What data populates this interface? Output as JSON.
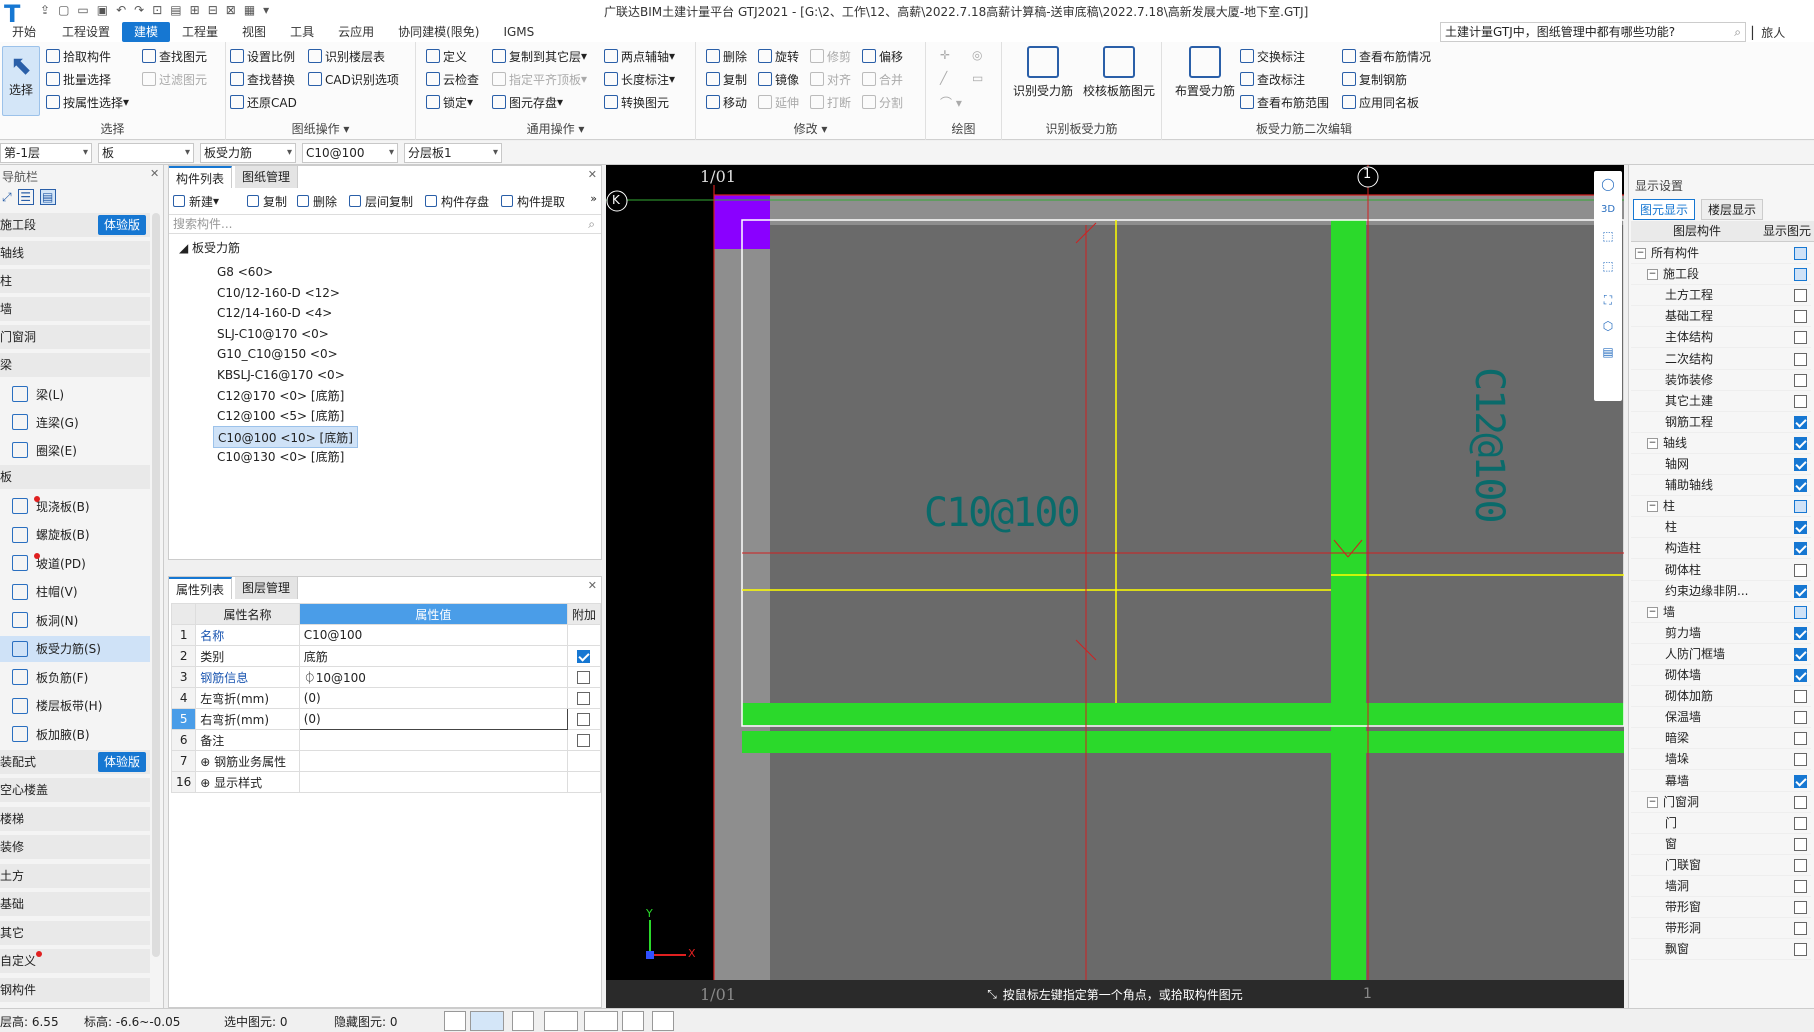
{
  "window_title": "广联达BIM土建计量平台 GTJ2021 - [G:\\2、工作\\12、高薪\\2022.7.18高薪计算稿-送审底稿\\2022.7.18\\高新发展大厦-地下室.GTJ]",
  "menu_tabs": [
    "开始",
    "工程设置",
    "建模",
    "工程量",
    "视图",
    "工具",
    "云应用",
    "协同建模(限免)",
    "IGMS"
  ],
  "active_tab": "建模",
  "help_search": "土建计量GTJ中，图纸管理中都有哪些功能?",
  "user": "旅人",
  "ribbon": {
    "select_big": "选择",
    "select_items": [
      "拾取构件",
      "批量选择",
      "按属性选择",
      "查找图元",
      "过滤图元"
    ],
    "select_group": "选择",
    "drawing_items": [
      "设置比例",
      "识别楼层表",
      "查找替换",
      "CAD识别选项",
      "还原CAD"
    ],
    "drawing_group": "图纸操作 ▾",
    "general_items": [
      "定义",
      "复制到其它层",
      "两点辅轴",
      "云检查",
      "指定平齐顶板",
      "长度标注",
      "锁定",
      "图元存盘",
      "转换图元"
    ],
    "general_group": "通用操作 ▾",
    "modify_items": [
      "删除",
      "旋转",
      "修剪",
      "偏移",
      "复制",
      "镜像",
      "对齐",
      "合并",
      "移动",
      "延伸",
      "打断",
      "分割"
    ],
    "modify_group": "修改 ▾",
    "draw_group": "绘图",
    "recog_items": [
      "识别受力筋",
      "校核板筋图元"
    ],
    "recog_group": "识别板受力筋",
    "edit_big": "布置受力筋",
    "edit_items": [
      "交换标注",
      "查改标注",
      "查看布筋范围",
      "查看布筋情况",
      "复制钢筋",
      "应用同名板"
    ],
    "edit_group": "板受力筋二次编辑"
  },
  "selectors": [
    "第-1层",
    "板",
    "板受力筋",
    "C10@100",
    "分层板1"
  ],
  "nav": {
    "title": "导航栏",
    "sections": [
      {
        "label": "施工段",
        "badge": "体验版"
      },
      {
        "label": "轴线"
      },
      {
        "label": "柱"
      },
      {
        "label": "墙"
      },
      {
        "label": "门窗洞"
      },
      {
        "label": "梁"
      }
    ],
    "beam_items": [
      "梁(L)",
      "连梁(G)",
      "圈梁(E)"
    ],
    "slab_section": "板",
    "slab_items": [
      "现浇板(B)",
      "螺旋板(B)",
      "坡道(PD)",
      "柱帽(V)",
      "板洞(N)",
      "板受力筋(S)",
      "板负筋(F)",
      "楼层板带(H)",
      "板加腋(B)"
    ],
    "lower_sections": [
      {
        "label": "装配式",
        "badge": "体验版"
      },
      {
        "label": "空心楼盖"
      },
      {
        "label": "楼梯"
      },
      {
        "label": "装修"
      },
      {
        "label": "土方"
      },
      {
        "label": "基础"
      },
      {
        "label": "其它"
      },
      {
        "label": "自定义"
      },
      {
        "label": "钢构件"
      }
    ]
  },
  "component_panel": {
    "tabs": [
      "构件列表",
      "图纸管理"
    ],
    "tools": [
      "新建",
      "复制",
      "删除",
      "层间复制",
      "构件存盘",
      "构件提取"
    ],
    "search_placeholder": "搜索构件...",
    "root": "板受力筋",
    "items": [
      "G8 <60>",
      "C10/12-160-D <12>",
      "C12/14-160-D <4>",
      "SLJ-C10@170 <0>",
      "G10_C10@150 <0>",
      "KBSLJ-C16@170 <0>",
      "C12@170 <0> [底筋]",
      "C12@100 <5> [底筋]",
      "C10@100 <10> [底筋]",
      "C10@130 <0> [底筋]"
    ],
    "selected_index": 8
  },
  "properties": {
    "tabs": [
      "属性列表",
      "图层管理"
    ],
    "headers": [
      "属性名称",
      "属性值",
      "附加"
    ],
    "rows": [
      {
        "num": "1",
        "name": "名称",
        "value": "C10@100",
        "link": true,
        "check": null
      },
      {
        "num": "2",
        "name": "类别",
        "value": "底筋",
        "link": false,
        "check": true
      },
      {
        "num": "3",
        "name": "钢筋信息",
        "value": "⏀10@100",
        "link": true,
        "check": false
      },
      {
        "num": "4",
        "name": "左弯折(mm)",
        "value": "(0)",
        "link": false,
        "check": false
      },
      {
        "num": "5",
        "name": "右弯折(mm)",
        "value": "(0)",
        "link": false,
        "check": false
      },
      {
        "num": "6",
        "name": "备注",
        "value": "",
        "link": false,
        "check": false
      },
      {
        "num": "7",
        "name": "⊕ 钢筋业务属性",
        "value": "",
        "link": false,
        "check": null
      },
      {
        "num": "16",
        "name": "⊕ 显示样式",
        "value": "",
        "link": false,
        "check": null
      }
    ]
  },
  "canvas": {
    "axis_top_left": "1/01",
    "axis_top_right": "1",
    "axis_left": "K",
    "axis_bottom_left": "1/01",
    "axis_bottom_right": "1",
    "label_horizontal": "C10@100",
    "label_vertical": "C12@100",
    "prompt": "按鼠标左键指定第一个角点，或拾取构件图元",
    "x_label": "X",
    "y_label": "Y"
  },
  "display_settings": {
    "title": "显示设置",
    "tabs": [
      "图元显示",
      "楼层显示"
    ],
    "headers": [
      "图层构件",
      "显示图元"
    ],
    "rows": [
      {
        "label": "所有构件",
        "level": 0,
        "group": true,
        "checked": "partial"
      },
      {
        "label": "施工段",
        "level": 1,
        "group": true,
        "checked": "partial"
      },
      {
        "label": "土方工程",
        "level": 2,
        "checked": false
      },
      {
        "label": "基础工程",
        "level": 2,
        "checked": false
      },
      {
        "label": "主体结构",
        "level": 2,
        "checked": false
      },
      {
        "label": "二次结构",
        "level": 2,
        "checked": false
      },
      {
        "label": "装饰装修",
        "level": 2,
        "checked": false
      },
      {
        "label": "其它土建",
        "level": 2,
        "checked": false
      },
      {
        "label": "钢筋工程",
        "level": 2,
        "checked": true
      },
      {
        "label": "轴线",
        "level": 1,
        "group": true,
        "checked": true
      },
      {
        "label": "轴网",
        "level": 2,
        "checked": true
      },
      {
        "label": "辅助轴线",
        "level": 2,
        "checked": true
      },
      {
        "label": "柱",
        "level": 1,
        "group": true,
        "checked": "partial"
      },
      {
        "label": "柱",
        "level": 2,
        "checked": true
      },
      {
        "label": "构造柱",
        "level": 2,
        "checked": true
      },
      {
        "label": "砌体柱",
        "level": 2,
        "checked": false
      },
      {
        "label": "约束边缘非阴...",
        "level": 2,
        "checked": true
      },
      {
        "label": "墙",
        "level": 1,
        "group": true,
        "checked": "partial"
      },
      {
        "label": "剪力墙",
        "level": 2,
        "checked": true
      },
      {
        "label": "人防门框墙",
        "level": 2,
        "checked": true
      },
      {
        "label": "砌体墙",
        "level": 2,
        "checked": true
      },
      {
        "label": "砌体加筋",
        "level": 2,
        "checked": false
      },
      {
        "label": "保温墙",
        "level": 2,
        "checked": false
      },
      {
        "label": "暗梁",
        "level": 2,
        "checked": false
      },
      {
        "label": "墙垛",
        "level": 2,
        "checked": false
      },
      {
        "label": "幕墙",
        "level": 2,
        "checked": true
      },
      {
        "label": "门窗洞",
        "level": 1,
        "group": true,
        "checked": false
      },
      {
        "label": "门",
        "level": 2,
        "checked": false
      },
      {
        "label": "窗",
        "level": 2,
        "checked": false
      },
      {
        "label": "门联窗",
        "level": 2,
        "checked": false
      },
      {
        "label": "墙洞",
        "level": 2,
        "checked": false
      },
      {
        "label": "带形窗",
        "level": 2,
        "checked": false
      },
      {
        "label": "带形洞",
        "level": 2,
        "checked": false
      },
      {
        "label": "飘窗",
        "level": 2,
        "checked": false
      }
    ]
  },
  "status": {
    "floor_height": "层高:  6.55",
    "elevation": "标高:  -6.6~-0.05",
    "selected": "选中图元: 0",
    "hidden": "隐藏图元: 0"
  }
}
